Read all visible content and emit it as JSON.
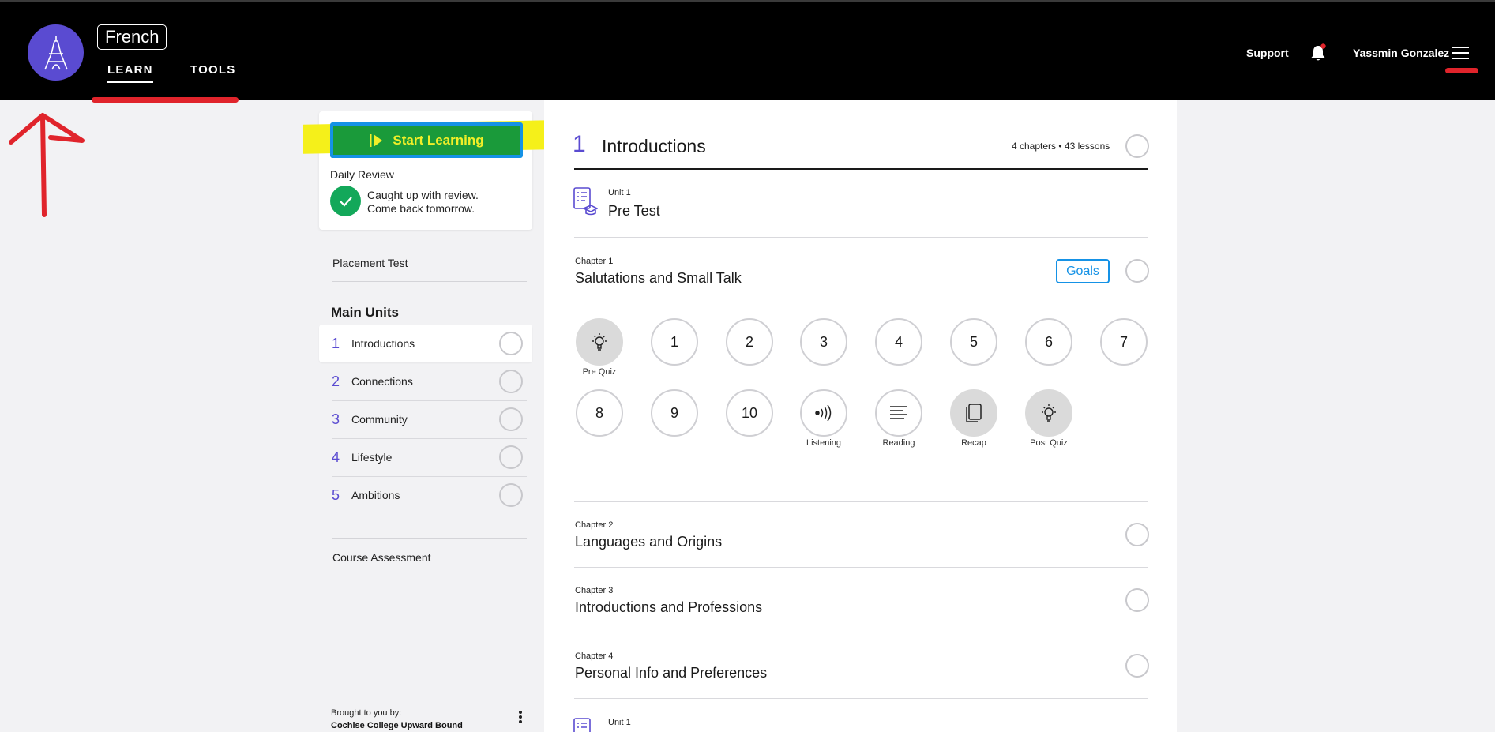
{
  "header": {
    "course_name": "French",
    "tabs": [
      {
        "label": "LEARN"
      },
      {
        "label": "TOOLS"
      }
    ],
    "support_label": "Support",
    "user_name": "Yassmin Gonzalez",
    "notification_dot_color": "#e0242b"
  },
  "sidebar": {
    "start_button_label": "Start Learning",
    "daily_review_label": "Daily Review",
    "daily_review_line1": "Caught up with review.",
    "daily_review_line2": "Come back tomorrow.",
    "placement_test": "Placement Test",
    "main_units_heading": "Main Units",
    "units": [
      {
        "num": "1",
        "name": "Introductions"
      },
      {
        "num": "2",
        "name": "Connections"
      },
      {
        "num": "3",
        "name": "Community"
      },
      {
        "num": "4",
        "name": "Lifestyle"
      },
      {
        "num": "5",
        "name": "Ambitions"
      }
    ],
    "course_assessment": "Course Assessment",
    "brought_by": "Brought to you by:",
    "sponsor": "Cochise College Upward Bound"
  },
  "main": {
    "unit_number": "1",
    "unit_title": "Introductions",
    "unit_counts": "4 chapters • 43 lessons",
    "pretest": {
      "label": "Unit 1",
      "title": "Pre Test"
    },
    "chapter1": {
      "label": "Chapter 1",
      "title": "Salutations and Small Talk",
      "goals_label": "Goals"
    },
    "lessons": {
      "pre_quiz": "Pre Quiz",
      "numbers": [
        "1",
        "2",
        "3",
        "4",
        "5",
        "6",
        "7",
        "8",
        "9",
        "10"
      ],
      "listening": "Listening",
      "reading": "Reading",
      "recap": "Recap",
      "post_quiz": "Post Quiz"
    },
    "chapters": [
      {
        "label": "Chapter 2",
        "title": "Languages and Origins"
      },
      {
        "label": "Chapter 3",
        "title": "Introductions and Professions"
      },
      {
        "label": "Chapter 4",
        "title": "Personal Info and Preferences"
      }
    ],
    "posttest": {
      "label": "Unit 1"
    }
  },
  "colors": {
    "accent": "#5a4bd1",
    "start_button_bg": "#1a9a3a",
    "start_button_border": "#1592e6",
    "annotation_red": "#e0242b",
    "annotation_yellow": "#f5f01a"
  }
}
